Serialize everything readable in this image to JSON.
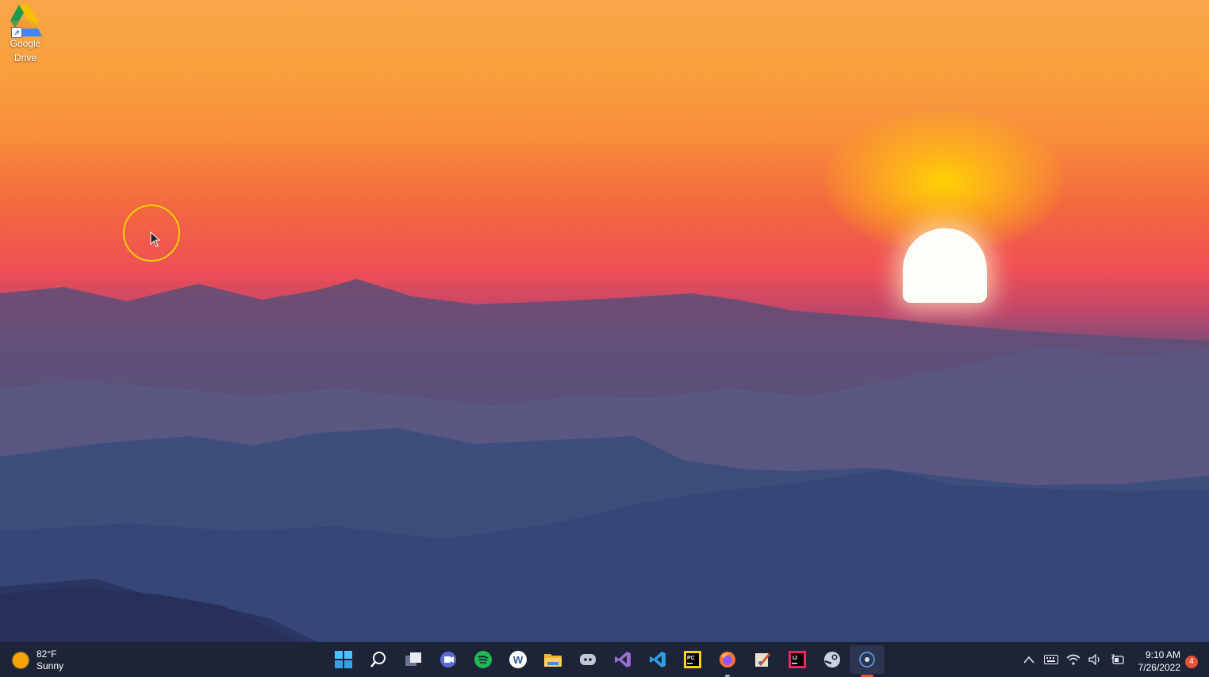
{
  "desktop": {
    "icons": [
      {
        "label": "Google\nDrive",
        "icon": "google-drive-icon"
      }
    ]
  },
  "taskbar": {
    "weather": {
      "temperature": "82°F",
      "condition": "Sunny",
      "icon": "sun-icon"
    },
    "apps": [
      {
        "name": "Start",
        "icon": "windows-start-icon",
        "active": false,
        "running": false
      },
      {
        "name": "Search",
        "icon": "search-icon",
        "active": false,
        "running": false
      },
      {
        "name": "Task View",
        "icon": "task-view-icon",
        "active": false,
        "running": false
      },
      {
        "name": "Teams Chat",
        "icon": "teams-chat-icon",
        "active": false,
        "running": false
      },
      {
        "name": "Spotify",
        "icon": "spotify-icon",
        "active": false,
        "running": false
      },
      {
        "name": "Word",
        "icon": "word-icon",
        "active": false,
        "running": false
      },
      {
        "name": "File Explorer",
        "icon": "file-explorer-icon",
        "active": false,
        "running": false
      },
      {
        "name": "Discord",
        "icon": "discord-icon",
        "active": false,
        "running": false
      },
      {
        "name": "Visual Studio",
        "icon": "visual-studio-icon",
        "active": false,
        "running": false
      },
      {
        "name": "Visual Studio Code",
        "icon": "vscode-icon",
        "active": false,
        "running": false
      },
      {
        "name": "PyCharm",
        "icon": "pycharm-icon",
        "active": false,
        "running": false
      },
      {
        "name": "Firefox",
        "icon": "firefox-icon",
        "active": false,
        "running": true
      },
      {
        "name": "Paint Tool",
        "icon": "paint-tool-icon",
        "active": false,
        "running": false
      },
      {
        "name": "IntelliJ IDEA",
        "icon": "intellij-icon",
        "active": false,
        "running": false
      },
      {
        "name": "Steam",
        "icon": "steam-icon",
        "active": false,
        "running": false
      },
      {
        "name": "Screen Recorder",
        "icon": "recorder-icon",
        "active": true,
        "running": true
      }
    ],
    "tray": {
      "icons": [
        "chevron-up-icon",
        "keyboard-icon",
        "wifi-icon",
        "volume-icon",
        "battery-icon"
      ]
    },
    "clock": {
      "time": "9:10 AM",
      "date": "7/26/2022"
    },
    "notification_count": "4"
  },
  "colors": {
    "taskbar_bg": "#1e2437",
    "accent": "#e8503a",
    "cursor_ring": "#f0d000"
  }
}
